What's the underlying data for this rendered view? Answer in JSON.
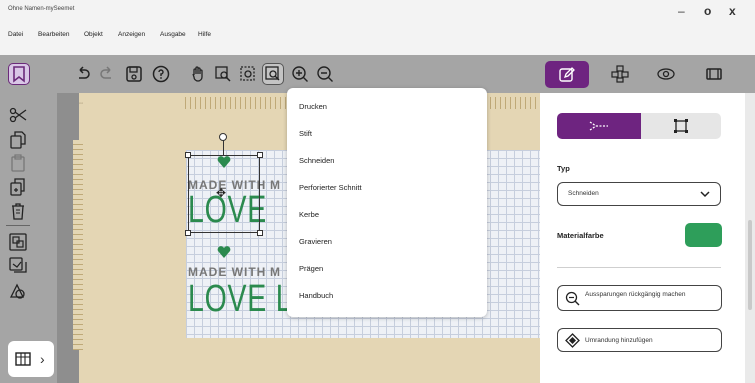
{
  "window": {
    "title": "Ohne Namen-mySeemet",
    "controls": [
      "–",
      "o",
      "x"
    ]
  },
  "menubar": {
    "items": [
      "Datei",
      "Bearbeiten",
      "Objekt",
      "Anzeigen",
      "Ausgabe",
      "Hilfe"
    ]
  },
  "dropdown": {
    "items": [
      "Drucken",
      "Stift",
      "Schneiden",
      "Perforierter Schnitt",
      "Kerbe",
      "Gravieren",
      "Prägen",
      "Handbuch"
    ]
  },
  "canvas": {
    "design_text_top": "MADE WITH",
    "design_text_love": "LOVE",
    "design_text_love2": "LOVE LOVE"
  },
  "panel": {
    "typ_label": "Typ",
    "typ_value": "Schneiden",
    "materialfarbe_label": "Materialfarbe",
    "materialfarbe_color": "#2e9e5a",
    "btn_aussparungen": "Aussparungen rückgängig machen",
    "btn_umrandung": "Umrandung hinzufügen"
  },
  "colors": {
    "accent": "#6e2480",
    "toolbar_bg": "#a5a5a5",
    "mat": "#e4d6b4",
    "love_green": "#2b8a4e"
  },
  "icons": {
    "left_tools": [
      "scissors-icon",
      "copy-icon",
      "paste-icon",
      "duplicate-icon",
      "trash-icon",
      "group-icon",
      "ungroup-icon",
      "shape-icon"
    ],
    "bottom_corner": [
      "grid-icon",
      "chevron-right-icon"
    ]
  },
  "corner": {
    "chevron": "›"
  }
}
